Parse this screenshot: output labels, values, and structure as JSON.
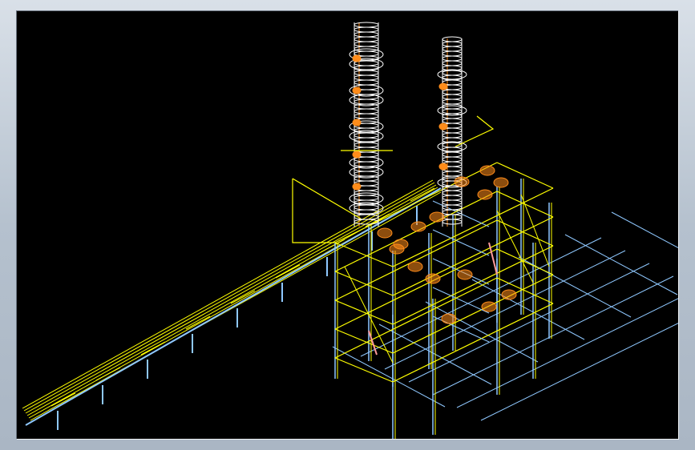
{
  "window": {
    "frame_color": "#b5c1ce"
  },
  "viewport": {
    "background": "#000000",
    "colors": {
      "structure": "#ffff00",
      "steel": "#8fc8ff",
      "column_shell": "#ffffff",
      "equipment": "#ff8c1a",
      "piping": "#ff9a9a"
    },
    "icons": [
      "wireframe-column",
      "pipe-rack",
      "grid-axes"
    ]
  }
}
